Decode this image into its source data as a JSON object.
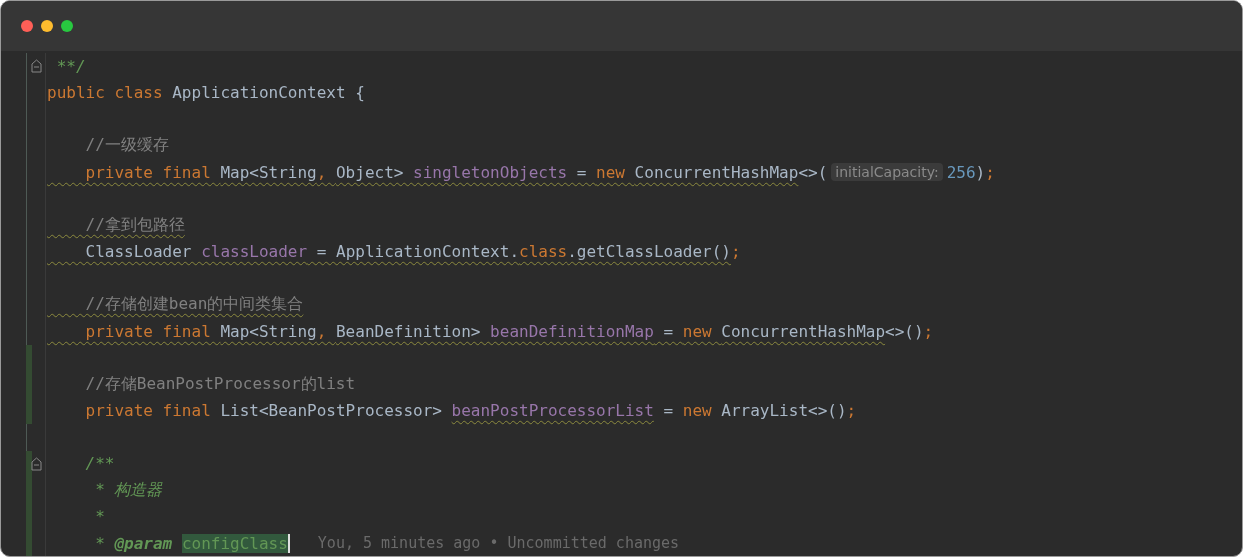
{
  "window": {
    "controls": [
      {
        "kind": "close"
      },
      {
        "kind": "minimize"
      },
      {
        "kind": "zoom"
      }
    ]
  },
  "lines": [
    {
      "changed": false,
      "fold": true,
      "tokens": [
        {
          "text": " **/",
          "kind": "doc"
        }
      ]
    },
    {
      "changed": false,
      "fold": false,
      "tokens": [
        {
          "text": "public class ",
          "kind": "keyword"
        },
        {
          "text": "ApplicationContext {",
          "kind": "plain"
        }
      ]
    },
    {
      "changed": false,
      "fold": false
    },
    {
      "changed": false,
      "fold": false,
      "tokens": [
        {
          "text": "    //一级缓存",
          "kind": "comment"
        }
      ]
    },
    {
      "changed": false,
      "fold": false,
      "tokens": [
        {
          "text": "    private final ",
          "kind": "keyword",
          "warn": true
        },
        {
          "text": "Map<String",
          "kind": "plain",
          "warn": true
        },
        {
          "text": ", ",
          "kind": "keyword",
          "warn": true
        },
        {
          "text": "Object> ",
          "kind": "plain",
          "warn": true
        },
        {
          "text": "singletonObjects",
          "kind": "field",
          "warn": true
        },
        {
          "text": " = ",
          "kind": "plain",
          "warn": true
        },
        {
          "text": "new ",
          "kind": "keyword",
          "warn": true
        },
        {
          "text": "ConcurrentHashMap",
          "kind": "plain",
          "warn": true
        },
        {
          "text": "<>(",
          "kind": "plain"
        },
        {
          "text": "initialCapacity:",
          "kind": "hint"
        },
        {
          "text": "256",
          "kind": "number"
        },
        {
          "text": ")",
          "kind": "plain"
        },
        {
          "text": ";",
          "kind": "keyword"
        }
      ]
    },
    {
      "changed": false,
      "fold": false
    },
    {
      "changed": false,
      "fold": false,
      "tokens": [
        {
          "text": "    //拿到包路径",
          "kind": "comment",
          "warn": true
        }
      ]
    },
    {
      "changed": false,
      "fold": false,
      "tokens": [
        {
          "text": "    ClassLoader ",
          "kind": "plain",
          "warn": true
        },
        {
          "text": "classLoader",
          "kind": "field",
          "warn": true
        },
        {
          "text": " = ApplicationContext.",
          "kind": "plain",
          "warn": true
        },
        {
          "text": "class",
          "kind": "keyword",
          "warn": true
        },
        {
          "text": ".getClassLoader()",
          "kind": "plain",
          "warn": true
        },
        {
          "text": ";",
          "kind": "keyword"
        }
      ]
    },
    {
      "changed": false,
      "fold": false
    },
    {
      "changed": false,
      "fold": false,
      "tokens": [
        {
          "text": "    //存储创建bean的中间类集合",
          "kind": "comment",
          "warn": true
        }
      ]
    },
    {
      "changed": false,
      "fold": false,
      "tokens": [
        {
          "text": "    private final ",
          "kind": "keyword",
          "warn": true
        },
        {
          "text": "Map<String",
          "kind": "plain",
          "warn": true
        },
        {
          "text": ", ",
          "kind": "keyword",
          "warn": true
        },
        {
          "text": "BeanDefinition> ",
          "kind": "plain",
          "warn": true
        },
        {
          "text": "beanDefinitionMap",
          "kind": "field",
          "warn": true
        },
        {
          "text": " = ",
          "kind": "plain",
          "warn": true
        },
        {
          "text": "new ",
          "kind": "keyword",
          "warn": true
        },
        {
          "text": "ConcurrentHashMap",
          "kind": "plain",
          "warn": true
        },
        {
          "text": "<>()",
          "kind": "plain"
        },
        {
          "text": ";",
          "kind": "keyword"
        }
      ]
    },
    {
      "changed": true,
      "fold": false
    },
    {
      "changed": true,
      "fold": false,
      "tokens": [
        {
          "text": "    //存储BeanPostProcessor的list",
          "kind": "comment"
        }
      ]
    },
    {
      "changed": true,
      "fold": false,
      "tokens": [
        {
          "text": "    private final ",
          "kind": "keyword"
        },
        {
          "text": "List<BeanPostProcessor> ",
          "kind": "plain"
        },
        {
          "text": "beanPostProcessorList",
          "kind": "field",
          "warn": true
        },
        {
          "text": " = ",
          "kind": "plain"
        },
        {
          "text": "new ",
          "kind": "keyword"
        },
        {
          "text": "ArrayList<>()",
          "kind": "plain"
        },
        {
          "text": ";",
          "kind": "keyword"
        }
      ]
    },
    {
      "changed": false,
      "fold": false
    },
    {
      "changed": true,
      "fold": true,
      "tokens": [
        {
          "text": "    /**",
          "kind": "doc"
        }
      ]
    },
    {
      "changed": true,
      "fold": false,
      "tokens": [
        {
          "text": "     * 构造器",
          "kind": "doc"
        }
      ]
    },
    {
      "changed": true,
      "fold": false,
      "tokens": [
        {
          "text": "     *",
          "kind": "doc"
        }
      ]
    },
    {
      "changed": true,
      "fold": false,
      "tokens": [
        {
          "text": "     * ",
          "kind": "doc"
        },
        {
          "text": "@param ",
          "kind": "doctag"
        },
        {
          "text": "configClass",
          "kind": "param"
        },
        {
          "text": "You, 5 minutes ago • Uncommitted changes",
          "kind": "blame"
        }
      ]
    }
  ]
}
